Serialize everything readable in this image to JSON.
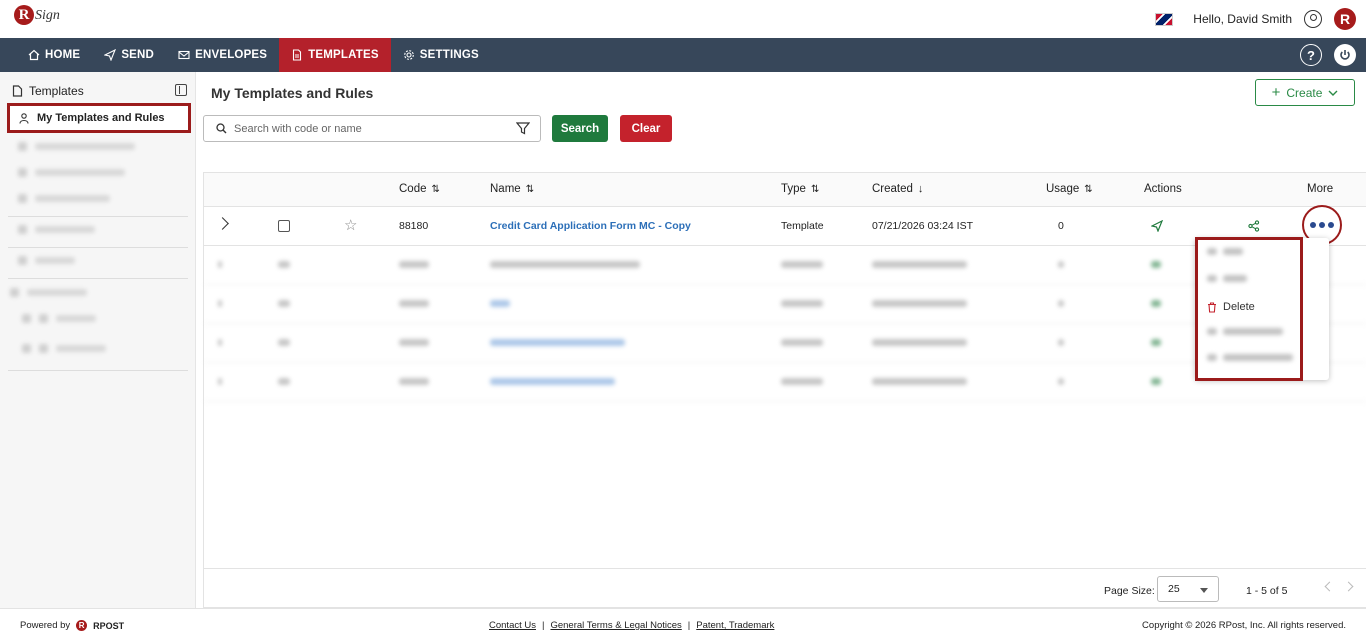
{
  "brand": {
    "logo_text": "Sign",
    "logo_letter": "R"
  },
  "user": {
    "greeting": "Hello, David Smith"
  },
  "nav": {
    "items": [
      {
        "label": "HOME"
      },
      {
        "label": "SEND"
      },
      {
        "label": "ENVELOPES"
      },
      {
        "label": "TEMPLATES"
      },
      {
        "label": "SETTINGS"
      }
    ],
    "active": "TEMPLATES",
    "help": "?"
  },
  "sidebar": {
    "header": "Templates",
    "active_item": "My Templates and Rules"
  },
  "main": {
    "title": "My Templates and Rules",
    "create_label": "Create",
    "search_placeholder": "Search with code or name",
    "search_label": "Search",
    "clear_label": "Clear"
  },
  "table": {
    "columns": [
      {
        "label": "Code",
        "sort": "both"
      },
      {
        "label": "Name",
        "sort": "both"
      },
      {
        "label": "Type",
        "sort": "both"
      },
      {
        "label": "Created",
        "sort": "desc"
      },
      {
        "label": "Usage",
        "sort": "both"
      },
      {
        "label": "Actions"
      },
      {
        "label": "More"
      }
    ],
    "rows": [
      {
        "code": "88180",
        "name": "Credit Card Application Form MC - Copy",
        "type": "Template",
        "created": "07/21/2026 03:24 IST",
        "usage": "0"
      }
    ]
  },
  "more_menu": {
    "visible_item": "Delete"
  },
  "pager": {
    "page_size_label": "Page Size:",
    "page_size": "25",
    "range": "1 - 5 of 5"
  },
  "footer": {
    "powered_by": "Powered by",
    "rpost": "RPOST",
    "links": [
      "Contact Us",
      "General Terms & Legal Notices",
      "Patent, Trademark"
    ],
    "separator": "|",
    "copyright": "Copyright © 2026 RPost, Inc. All rights reserved."
  },
  "colors": {
    "nav_bg": "#37475a",
    "active_red": "#b4212b",
    "search_green": "#1f7a3d",
    "clear_red": "#c4222c",
    "link_blue": "#2c6fb8",
    "highlight_frame": "#9b1b1b"
  }
}
